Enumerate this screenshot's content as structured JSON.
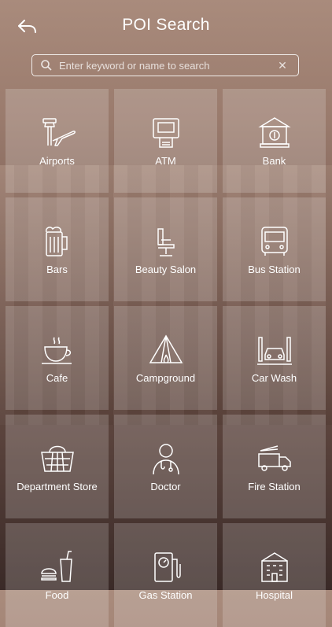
{
  "header": {
    "title": "POI Search"
  },
  "search": {
    "placeholder": "Enter keyword or name to search"
  },
  "categories": [
    {
      "label": "Airports",
      "icon": "airport-icon"
    },
    {
      "label": "ATM",
      "icon": "atm-icon"
    },
    {
      "label": "Bank",
      "icon": "bank-icon"
    },
    {
      "label": "Bars",
      "icon": "beer-mug-icon"
    },
    {
      "label": "Beauty Salon",
      "icon": "salon-chair-icon"
    },
    {
      "label": "Bus Station",
      "icon": "bus-icon"
    },
    {
      "label": "Cafe",
      "icon": "coffee-cup-icon"
    },
    {
      "label": "Campground",
      "icon": "tent-icon"
    },
    {
      "label": "Car Wash",
      "icon": "car-wash-icon"
    },
    {
      "label": "Department Store",
      "icon": "shopping-basket-icon"
    },
    {
      "label": "Doctor",
      "icon": "doctor-icon"
    },
    {
      "label": "Fire Station",
      "icon": "fire-truck-icon"
    },
    {
      "label": "Food",
      "icon": "burger-drink-icon"
    },
    {
      "label": "Gas Station",
      "icon": "gas-pump-icon"
    },
    {
      "label": "Hospital",
      "icon": "hospital-icon"
    }
  ]
}
